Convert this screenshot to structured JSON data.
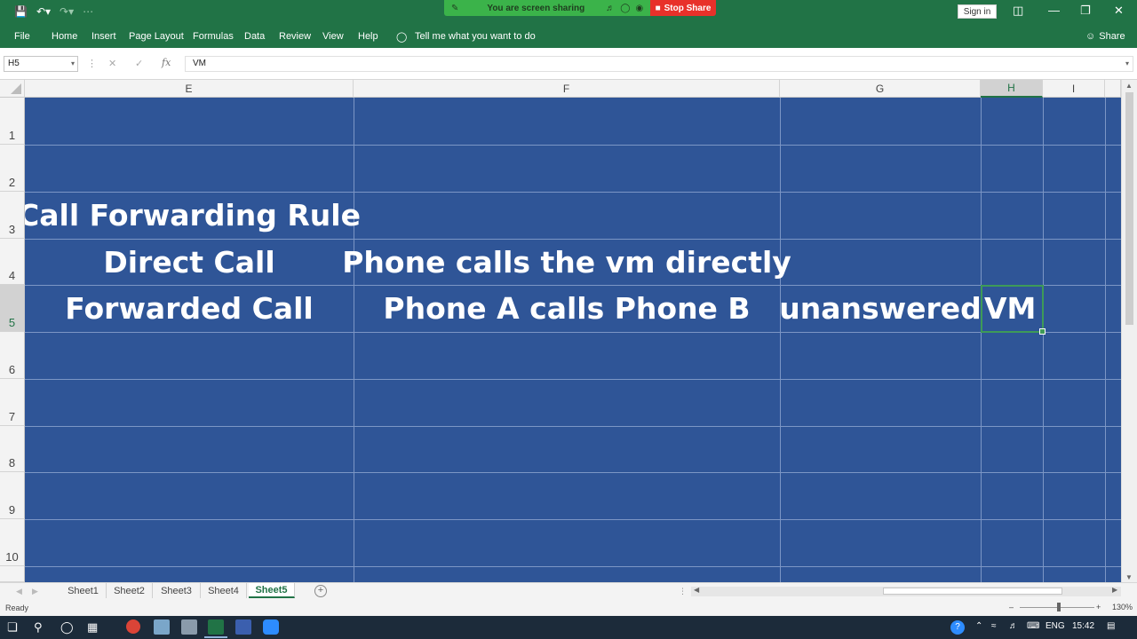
{
  "title_bar": {
    "quick_access": [
      "save-icon",
      "undo-icon",
      "redo-icon",
      "customize-icon"
    ],
    "share_banner": {
      "message": "You are screen sharing",
      "stop_label": "Stop Share"
    },
    "sign_in_label": "Sign in",
    "window_controls": [
      "ribbon-display-icon",
      "minimize-icon",
      "restore-icon",
      "close-icon"
    ]
  },
  "ribbon": {
    "tabs": [
      "File",
      "Home",
      "Insert",
      "Page Layout",
      "Formulas",
      "Data",
      "Review",
      "View",
      "Help"
    ],
    "tell_me": "Tell me what you want to do",
    "share_label": "Share"
  },
  "formula_bar": {
    "name_box": "H5",
    "fx_label": "fx",
    "formula": "VM"
  },
  "grid": {
    "columns": [
      "E",
      "F",
      "G",
      "H",
      "I"
    ],
    "selected_column": "H",
    "rows": [
      "1",
      "2",
      "3",
      "4",
      "5",
      "6",
      "7",
      "8",
      "9",
      "10"
    ],
    "fill_color": "#2f5597",
    "cells": {
      "E3": "Call Forwarding Rule",
      "E4": "Direct Call",
      "E5": "Forwarded Call",
      "F4": "Phone calls the vm directly",
      "F5": "Phone A calls Phone B",
      "G5": "unanswered",
      "H5": "VM"
    },
    "selected_cell": "H5"
  },
  "sheets": {
    "tabs": [
      "Sheet1",
      "Sheet2",
      "Sheet3",
      "Sheet4",
      "Sheet5"
    ],
    "active": "Sheet5"
  },
  "status_bar": {
    "status": "Ready",
    "zoom": "130%"
  },
  "taskbar": {
    "language": "ENG",
    "time": "15:42"
  },
  "colors": {
    "accent": "#217346",
    "selection": "#3e9a58",
    "stop_share": "#e8312a",
    "sharing": "#3bb34a"
  }
}
